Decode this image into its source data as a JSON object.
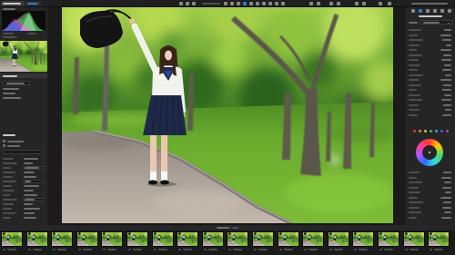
{
  "theme": {
    "background": "#151515",
    "panel": "#252525",
    "accent": "#2e7bd6"
  },
  "toolbar": {
    "left_tabs": [
      {
        "active": false
      },
      {
        "active": true
      }
    ],
    "tools": [
      {
        "active": false
      },
      {
        "active": false
      },
      {
        "active": false
      },
      {
        "active": false
      },
      {
        "active": false
      },
      {
        "active": false
      },
      {
        "active": true
      },
      {
        "active": false
      },
      {
        "active": false
      },
      {
        "active": false
      },
      {
        "active": false
      },
      {
        "active": false
      },
      {
        "active": false
      }
    ],
    "right_tools": [
      {
        "active": false
      },
      {
        "active": false
      },
      {
        "active": false
      },
      {
        "active": false
      },
      {
        "active": false
      },
      {
        "active": false
      },
      {
        "active": false
      },
      {
        "active": false
      }
    ]
  },
  "right_panel": {
    "color_swatches": [
      "#d8403a",
      "#e0862c",
      "#d8c23a",
      "#4cae48",
      "#3ab0b6",
      "#3b62d4",
      "#a24ac4"
    ]
  },
  "filmstrip": {
    "thumbnails": [
      {
        "selected": false
      },
      {
        "selected": false
      },
      {
        "selected": false
      },
      {
        "selected": false
      },
      {
        "selected": false
      },
      {
        "selected": false
      },
      {
        "selected": false
      },
      {
        "selected": false
      },
      {
        "selected": false
      },
      {
        "selected": false
      },
      {
        "selected": false
      },
      {
        "selected": false
      },
      {
        "selected": false
      },
      {
        "selected": false
      },
      {
        "selected": false
      },
      {
        "selected": false
      },
      {
        "selected": false
      },
      {
        "selected": false
      }
    ]
  }
}
